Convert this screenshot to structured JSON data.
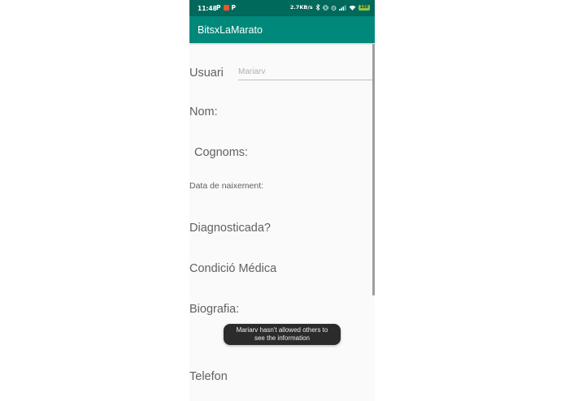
{
  "status_bar": {
    "time": "11:48",
    "left_icons": [
      "P",
      "app-notification",
      "P"
    ],
    "net_speed": "2.7KB/s",
    "battery": "100",
    "background_color": "#00695c"
  },
  "app_bar": {
    "title": "BitsxLaMarato",
    "background_color": "#00897b"
  },
  "form": {
    "usuari_label": "Usuari",
    "usuari_value": "Mariarv",
    "nom_label": "Nom:",
    "cognoms_label": "Cognoms:",
    "data_naixement_label": "Data de naixement:",
    "diagnosticada_label": "Diagnosticada?",
    "condicio_medica_label": "Condició Médica",
    "biografia_label": "Biografia:",
    "telefon_label": "Telefon"
  },
  "toast": {
    "message_line1": "Mariarv hasn't allowed others to",
    "message_line2": "see the information"
  }
}
